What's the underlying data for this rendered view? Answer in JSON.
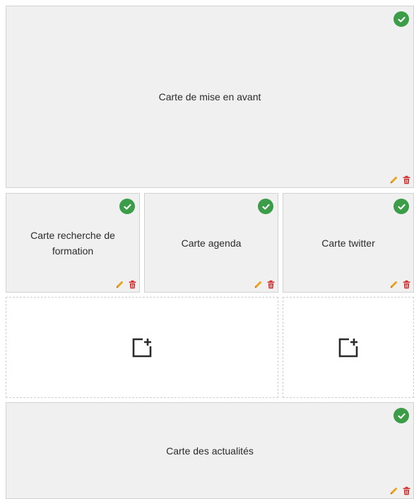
{
  "cards": {
    "hero": {
      "label": "Carte de mise en avant"
    },
    "formation": {
      "label": "Carte recherche de formation"
    },
    "agenda": {
      "label": "Carte agenda"
    },
    "twitter": {
      "label": "Carte twitter"
    },
    "news": {
      "label": "Carte des actualités"
    }
  },
  "icons": {
    "active": "check-circle-icon",
    "edit": "pencil-icon",
    "delete": "trash-icon",
    "add": "add-card-icon"
  },
  "colors": {
    "card_background": "#f0f0f0",
    "check_green": "#3c9d48",
    "edit_orange": "#e8a21b",
    "delete_red": "#d32f2f",
    "slot_border": "#cfcfcf"
  }
}
